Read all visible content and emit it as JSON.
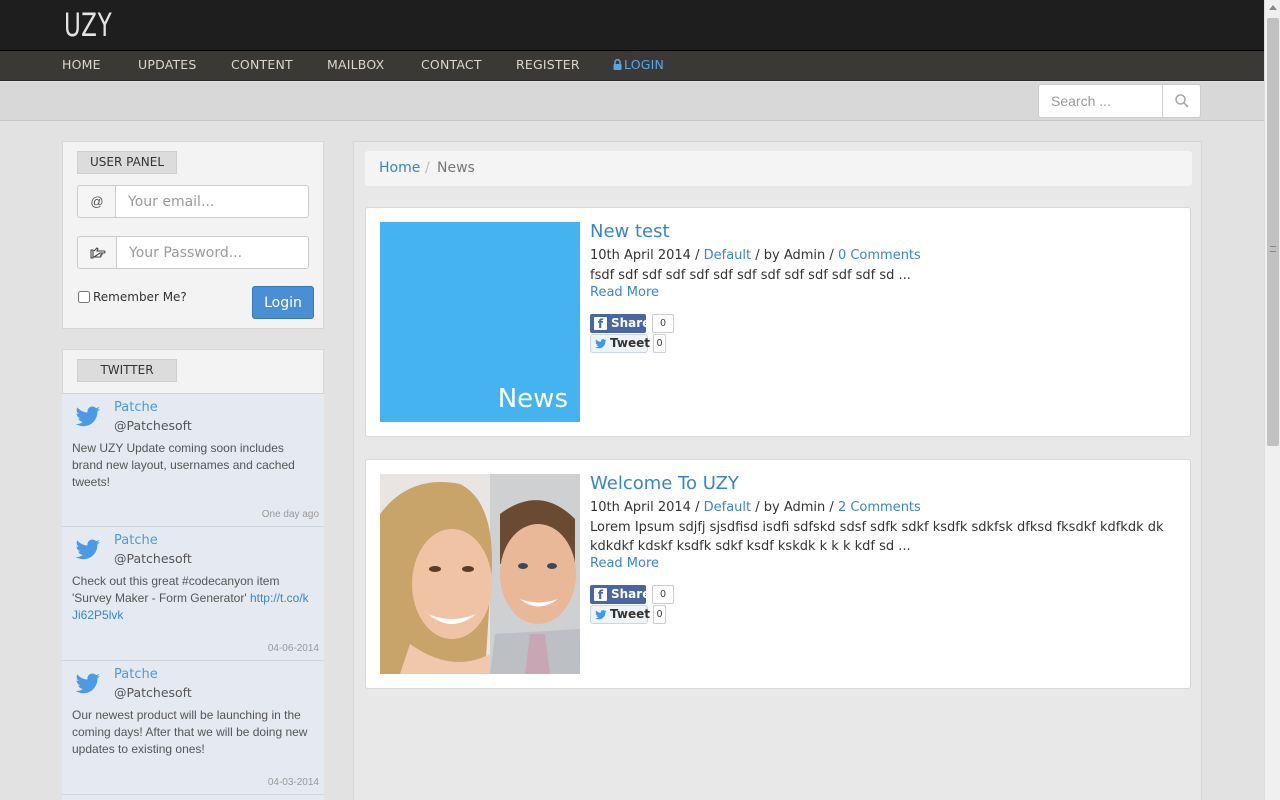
{
  "brand": {
    "logo": "UZY"
  },
  "nav": {
    "items": [
      {
        "label": "HOME"
      },
      {
        "label": "UPDATES"
      },
      {
        "label": "CONTENT"
      },
      {
        "label": "MAILBOX"
      },
      {
        "label": "CONTACT"
      },
      {
        "label": "REGISTER"
      },
      {
        "label": "LOGIN",
        "icon": "lock-icon"
      }
    ]
  },
  "search": {
    "placeholder": "Search ...",
    "icon": "search-icon"
  },
  "user_panel": {
    "title": "USER PANEL",
    "email_prefix": "@",
    "email_placeholder": "Your email...",
    "password_icon": "pointing-hand-icon",
    "password_placeholder": "Your Password...",
    "remember_label": "Remember Me?",
    "remember_checked": false,
    "login_label": "Login"
  },
  "twitter": {
    "title": "TWITTER",
    "tweets": [
      {
        "name": "Patche",
        "handle": "@Patchesoft",
        "text": "New UZY Update coming soon includes brand new layout, usernames and cached tweets!",
        "link": "",
        "time": "One day ago"
      },
      {
        "name": "Patche",
        "handle": "@Patchesoft",
        "text": "Check out this great #codecanyon item 'Survey Maker - Form Generator' ",
        "link": "http://t.co/kJi62P5lvk",
        "time": "04-06-2014"
      },
      {
        "name": "Patche",
        "handle": "@Patchesoft",
        "text": "Our newest product will be launching in the coming days! After that we will be doing new updates to existing ones!",
        "link": "",
        "time": "04-03-2014"
      }
    ]
  },
  "breadcrumb": {
    "home": "Home",
    "separator": "/",
    "current": "News"
  },
  "posts": [
    {
      "title": "New test",
      "date": "10th April 2014",
      "category": "Default",
      "author_prefix": "by Admin",
      "comments": "0 Comments",
      "excerpt": "fsdf sdf sdf sdf sdf sdf sdf sdf sdf sdf sdf sdf sd ...",
      "read_more": "Read More",
      "image_label": "News",
      "image_color": "#45b3f0",
      "share_label": "Share",
      "share_count": "0",
      "tweet_label": "Tweet",
      "tweet_count": "0"
    },
    {
      "title": "Welcome To UZY",
      "date": "10th April 2014",
      "category": "Default",
      "author_prefix": "by Admin",
      "comments": "2 Comments",
      "excerpt": "Lorem Ipsum sdjfj sjsdfisd isdfi sdfskd sdsf sdfk sdkf ksdfk sdkfsk dfksd fksdkf kdfkdk dk kdkdkf kdskf ksdfk sdkf ksdf kskdk k k k kdf sd ...",
      "read_more": "Read More",
      "image_label": "",
      "share_label": "Share",
      "share_count": "0",
      "tweet_label": "Tweet",
      "tweet_count": "0"
    }
  ],
  "colors": {
    "accent": "#3a84cc",
    "topbar": "#1e1e1e",
    "navbar": "#3b3935",
    "login_button": "#4a8ed3"
  }
}
